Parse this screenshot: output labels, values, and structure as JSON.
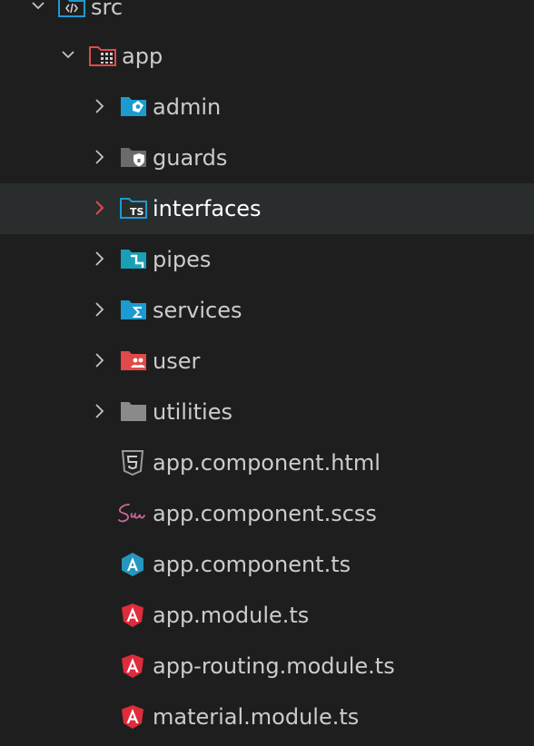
{
  "explorer": {
    "items": [
      {
        "label": "src",
        "kind": "folder",
        "icon": "src-folder-icon",
        "expanded": true
      },
      {
        "label": "app",
        "kind": "folder",
        "icon": "app-folder-icon",
        "expanded": true
      },
      {
        "label": "admin",
        "kind": "folder",
        "icon": "admin-folder-icon",
        "expanded": false
      },
      {
        "label": "guards",
        "kind": "folder",
        "icon": "guard-folder-icon",
        "expanded": false
      },
      {
        "label": "interfaces",
        "kind": "folder",
        "icon": "interfaces-folder-icon",
        "expanded": false,
        "selected": true
      },
      {
        "label": "pipes",
        "kind": "folder",
        "icon": "pipes-folder-icon",
        "expanded": false
      },
      {
        "label": "services",
        "kind": "folder",
        "icon": "services-folder-icon",
        "expanded": false
      },
      {
        "label": "user",
        "kind": "folder",
        "icon": "user-folder-icon",
        "expanded": false
      },
      {
        "label": "utilities",
        "kind": "folder",
        "icon": "folder-icon",
        "expanded": false
      },
      {
        "label": "app.component.html",
        "kind": "file",
        "icon": "html5-icon"
      },
      {
        "label": "app.component.scss",
        "kind": "file",
        "icon": "sass-icon"
      },
      {
        "label": "app.component.ts",
        "kind": "file",
        "icon": "angular-component-icon"
      },
      {
        "label": "app.module.ts",
        "kind": "file",
        "icon": "angular-icon"
      },
      {
        "label": "app-routing.module.ts",
        "kind": "file",
        "icon": "angular-icon"
      },
      {
        "label": "material.module.ts",
        "kind": "file",
        "icon": "angular-icon"
      }
    ]
  },
  "colors": {
    "background": "#1e1e1e",
    "selected_row": "#2a2d2e",
    "text": "#cccccc",
    "chevron": "#c5c5c5",
    "selected_chevron": "#e04a4a",
    "folder_blue": "#1c9bd0",
    "folder_red": "#e04a4a",
    "folder_gray": "#8a8a8a",
    "angular_red": "#dd2c3c",
    "angular_blue": "#2596be",
    "sass_pink": "#cd6799"
  }
}
